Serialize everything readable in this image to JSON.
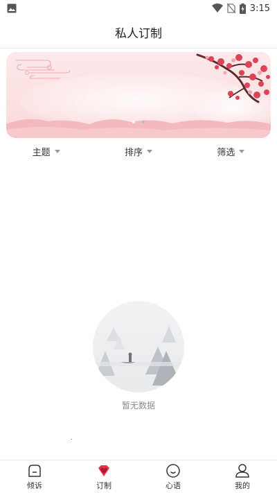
{
  "status_bar": {
    "time": "3:15",
    "icons": [
      "image-notification-icon",
      "wifi-icon",
      "no-sim-icon",
      "battery-charging-icon"
    ]
  },
  "header": {
    "title": "私人订制"
  },
  "banner": {
    "active_dot": 1,
    "dot_count": 2
  },
  "filters": [
    {
      "label": "主题"
    },
    {
      "label": "排序"
    },
    {
      "label": "筛选"
    }
  ],
  "empty_state": {
    "text": "暂无数据"
  },
  "tabbar": {
    "active_color": "#e8334a",
    "items": [
      {
        "label": "倾诉",
        "icon": "chat-bubble-icon"
      },
      {
        "label": "订制",
        "icon": "heart-gem-icon"
      },
      {
        "label": "心语",
        "icon": "smile-icon"
      },
      {
        "label": "我的",
        "icon": "user-icon"
      }
    ]
  }
}
